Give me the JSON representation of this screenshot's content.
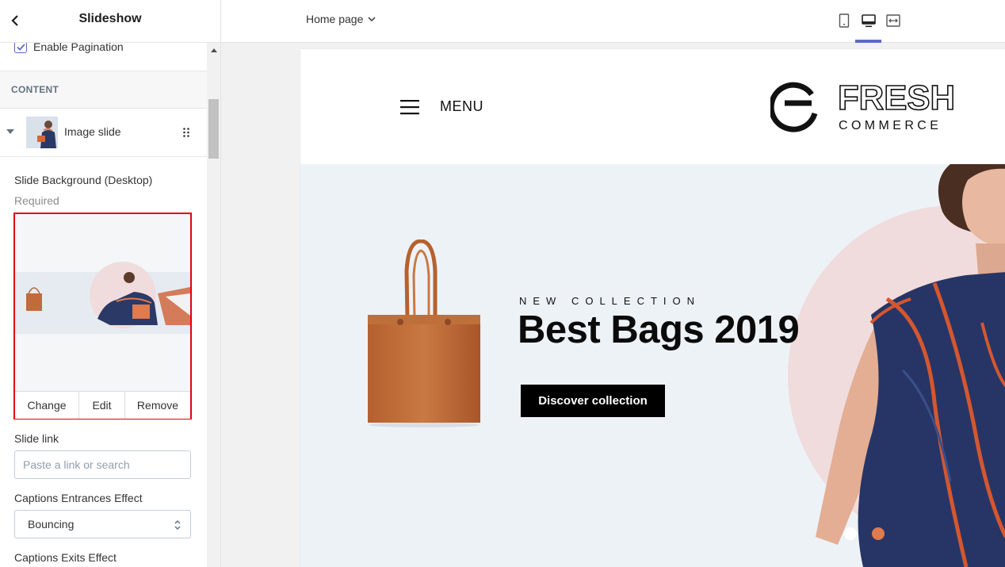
{
  "panel": {
    "title": "Slideshow",
    "enable_pagination_label": "Enable Pagination",
    "enable_pagination_checked": true,
    "section_label": "CONTENT",
    "block_label": "Image slide",
    "bg_label": "Slide Background (Desktop)",
    "bg_required": "Required",
    "picker_buttons": [
      "Change",
      "Edit",
      "Remove"
    ],
    "slide_link_label": "Slide link",
    "slide_link_placeholder": "Paste a link or search",
    "slide_link_value": "",
    "captions_enter_label": "Captions Entrances Effect",
    "captions_enter_value": "Bouncing",
    "captions_exit_label": "Captions Exits Effect"
  },
  "topbar": {
    "page_select": "Home page",
    "devices": [
      "mobile-icon",
      "desktop-icon",
      "full-width-icon"
    ],
    "active_device": "desktop-icon",
    "accent": "#5c6ac4"
  },
  "store": {
    "menu_label": "MENU",
    "logo_primary": "FRESH",
    "logo_secondary": "COMMERCE",
    "eyebrow": "NEW COLLECTION",
    "headline": "Best Bags 2019",
    "cta": "Discover collection",
    "pagination_dots": 2,
    "active_dot": 2,
    "dot_active_color": "#e07a4f"
  },
  "colors": {
    "picker_highlight": "#e3000f",
    "hero_bg": "#edf2f7",
    "circle": "#f0dcdc"
  }
}
